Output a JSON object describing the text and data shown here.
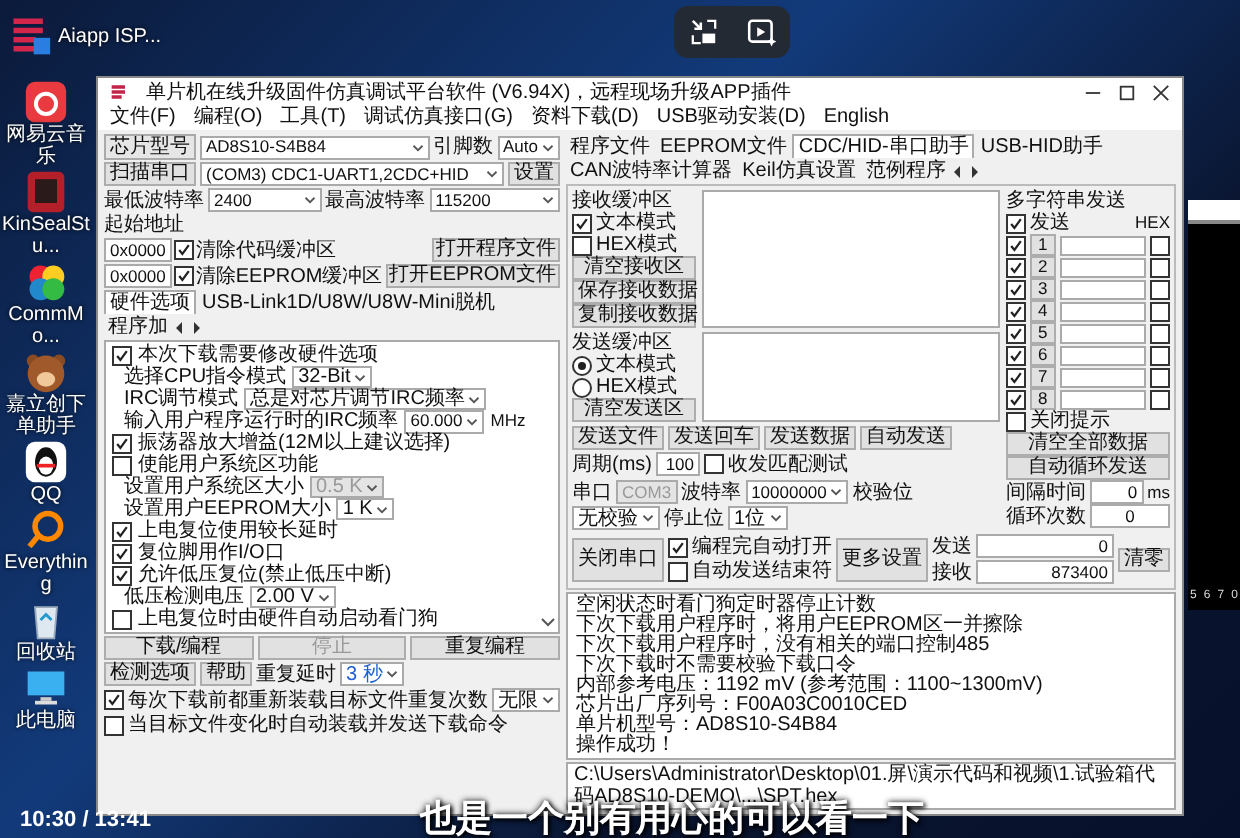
{
  "desktop": {
    "icons": [
      {
        "kind": "music",
        "label": "网易云音乐"
      },
      {
        "kind": "kinseal",
        "label": "KinSealStu..."
      },
      {
        "kind": "comm",
        "label": "CommMo..."
      },
      {
        "kind": "bear",
        "label": "嘉立创下单助手"
      },
      {
        "kind": "qq",
        "label": "QQ"
      },
      {
        "kind": "search",
        "label": "Everything"
      },
      {
        "kind": "recycle",
        "label": "回收站"
      },
      {
        "kind": "computer",
        "label": "此电脑"
      }
    ],
    "icons_column_2": [
      {
        "kind": "isp",
        "label": "Aiapp ISP..."
      }
    ]
  },
  "window": {
    "title": "单片机在线升级固件仿真调试平台软件 (V6.94X)，远程现场升级APP插件",
    "menu": [
      "文件(F)",
      "编程(O)",
      "工具(T)",
      "调试仿真接口(G)",
      "资料下载(D)",
      "USB驱动安装(D)",
      "English"
    ],
    "chip": {
      "label": "芯片型号",
      "value": "AD8S10-S4B84",
      "pins_label": "引脚数",
      "pins_value": "Auto"
    },
    "port": {
      "label": "扫描串口",
      "value": "(COM3) CDC1-UART1,2CDC+HID",
      "button": "设置"
    },
    "baud": {
      "min_label": "最低波特率",
      "min_value": "2400",
      "max_label": "最高波特率",
      "max_value": "115200"
    },
    "start_address": {
      "label": "起始地址",
      "rows": [
        {
          "address": "0x0000",
          "check_label": "清除代码缓冲区",
          "checked": true,
          "button": "打开程序文件"
        },
        {
          "address": "0x0000",
          "check_label": "清除EEPROM缓冲区",
          "checked": true,
          "button": "打开EEPROM文件"
        }
      ]
    },
    "left_tabs": [
      {
        "label": "硬件选项",
        "selected": true
      },
      {
        "label": "USB-Link1D/U8W/U8W-Mini脱机",
        "selected": false
      },
      {
        "label": "程序加",
        "selected": false
      }
    ],
    "options": [
      {
        "kind": "check",
        "label": "本次下载需要修改硬件选项",
        "checked": true
      },
      {
        "kind": "select",
        "label": "选择CPU指令模式",
        "value": "32-Bit",
        "disabled": false
      },
      {
        "kind": "select",
        "label": "IRC调节模式",
        "value": "总是对芯片调节IRC频率",
        "disabled": false
      },
      {
        "kind": "input",
        "label": "输入用户程序运行时的IRC频率",
        "value": "60.000",
        "unit": "MHz"
      },
      {
        "kind": "check",
        "label": "振荡器放大增益(12M以上建议选择)",
        "checked": true
      },
      {
        "kind": "check",
        "label": "使能用户系统区功能",
        "checked": false
      },
      {
        "kind": "select",
        "label": "设置用户系统区大小",
        "value": "0.5 K",
        "disabled": true
      },
      {
        "kind": "select",
        "label": "设置用户EEPROM大小",
        "value": "1 K",
        "disabled": false
      },
      {
        "kind": "check",
        "label": "上电复位使用较长延时",
        "checked": true
      },
      {
        "kind": "check",
        "label": "复位脚用作I/O口",
        "checked": true
      },
      {
        "kind": "check",
        "label": "允许低压复位(禁止低压中断)",
        "checked": true
      },
      {
        "kind": "select",
        "label": "低压检测电压",
        "value": "2.00 V",
        "disabled": false
      },
      {
        "kind": "check",
        "label": "上电复位时由硬件自动启动看门狗",
        "checked": false
      }
    ],
    "action_buttons": [
      {
        "label": "下载/编程",
        "disabled": false
      },
      {
        "label": "停止",
        "disabled": true
      },
      {
        "label": "重复编程",
        "disabled": false
      },
      {
        "label": "检测选项",
        "disabled": false
      },
      {
        "label": "帮助",
        "disabled": false
      }
    ],
    "repeat": {
      "delay_label": "重复延时",
      "delay_value": "3 秒",
      "count_label": "重复次数",
      "count_value": "无限"
    },
    "load_options": [
      {
        "label": "每次下载前都重新装载目标文件",
        "checked": true
      },
      {
        "label": "当目标文件变化时自动装载并发送下载命令",
        "checked": false
      }
    ],
    "right_tabs": [
      {
        "label": "程序文件",
        "selected": false
      },
      {
        "label": "EEPROM文件",
        "selected": false
      },
      {
        "label": "CDC/HID-串口助手",
        "selected": true
      },
      {
        "label": "USB-HID助手",
        "selected": false
      },
      {
        "label": "CAN波特率计算器",
        "selected": false
      },
      {
        "label": "Keil仿真设置",
        "selected": false
      },
      {
        "label": "范例程序",
        "selected": false
      }
    ],
    "receive": {
      "title": "接收缓冲区",
      "modes": [
        {
          "label": "文本模式",
          "checked": true
        },
        {
          "label": "HEX模式",
          "checked": false
        }
      ],
      "buttons": [
        "清空接收区",
        "保存接收数据",
        "复制接收数据"
      ]
    },
    "send": {
      "title": "发送缓冲区",
      "modes": [
        {
          "label": "文本模式",
          "selected": true
        },
        {
          "label": "HEX模式",
          "selected": false
        }
      ],
      "buttons": [
        "清空发送区"
      ]
    },
    "send_buttons": [
      "发送文件",
      "发送回车",
      "发送数据",
      "自动发送"
    ],
    "period": {
      "label": "周期(ms)",
      "value": "100",
      "match_label": "收发匹配测试",
      "match_checked": false
    },
    "serial": {
      "port_label": "串口",
      "port_value": "COM3",
      "port_disabled": true,
      "baud_label": "波特率",
      "baud_value": "10000000",
      "parity_label": "校验位",
      "parity_value": "无校验",
      "stop_label": "停止位",
      "stop_value": "1位"
    },
    "close_port": "关闭串口",
    "auto_options": [
      {
        "label": "编程完自动打开",
        "checked": true
      },
      {
        "label": "自动发送结束符",
        "checked": false
      }
    ],
    "more_settings": "更多设置",
    "counters": [
      {
        "label": "发送",
        "value": "0"
      },
      {
        "label": "接收",
        "value": "873400"
      }
    ],
    "clear": "清零",
    "multi_send": {
      "title": "多字符串发送",
      "send_label": "发送",
      "send_checked": true,
      "hex_label": "HEX",
      "rows": [
        {
          "number": "1",
          "checked": true,
          "hex": false
        },
        {
          "number": "2",
          "checked": true,
          "hex": false
        },
        {
          "number": "3",
          "checked": true,
          "hex": false
        },
        {
          "number": "4",
          "checked": true,
          "hex": false
        },
        {
          "number": "5",
          "checked": true,
          "hex": false
        },
        {
          "number": "6",
          "checked": true,
          "hex": false
        },
        {
          "number": "7",
          "checked": true,
          "hex": false
        },
        {
          "number": "8",
          "checked": true,
          "hex": false
        }
      ],
      "close_tip_label": "关闭提示",
      "close_tip_checked": false,
      "buttons": [
        "清空全部数据",
        "自动循环发送"
      ],
      "interval_label": "间隔时间",
      "interval_value": "0",
      "interval_unit": "ms",
      "loop_label": "循环次数",
      "loop_value": "0"
    },
    "log": [
      "空闲状态时看门狗定时器停止计数",
      "下次下载用户程序时，将用户EEPROM区一并擦除",
      "下次下载用户程序时，没有相关的端口控制485",
      "下次下载时不需要校验下载口令",
      "内部参考电压：1192 mV (参考范围：1100~1300mV)",
      "芯片出厂序列号：F00A03C0010CED",
      "单片机型号：AD8S10-S4B84",
      "操作成功！"
    ],
    "path": "C:\\Users\\Administrator\\Desktop\\01.屏\\演示代码和视频\\1.试验箱代码AD8S10-DEMO\\...\\SPT.hex"
  },
  "side_panel": {
    "ticks": [
      "5",
      "6",
      "7",
      "0"
    ]
  },
  "player": {
    "time": "10:30 / 13:41",
    "subtitle": "也是一个别有用心的可以看一下"
  }
}
